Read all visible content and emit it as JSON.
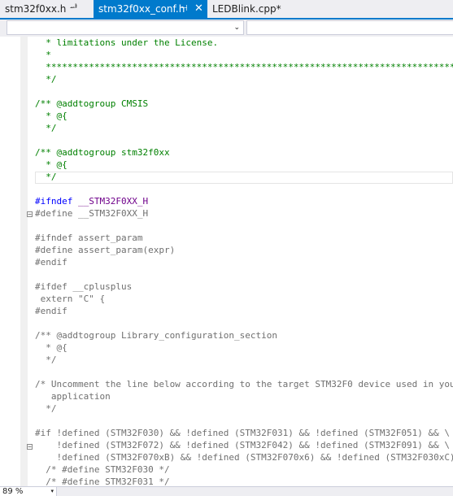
{
  "tabs": [
    {
      "label": "stm32f0xx.h",
      "pin": "ᆄ"
    },
    {
      "label": "stm32f0xx_conf.h",
      "pin": "⊣",
      "close": "✕"
    },
    {
      "label": "LEDBlink.cpp*"
    }
  ],
  "nav": {
    "scope_value": "",
    "member_value": "",
    "dropdown_glyph": "⌄"
  },
  "code_lines": [
    [
      {
        "t": "  * limitations under the License.",
        "c": "cm"
      }
    ],
    [
      {
        "t": "  *",
        "c": "cm"
      }
    ],
    [
      {
        "t": "  ******************************************************************************",
        "c": "cm"
      }
    ],
    [
      {
        "t": "  */",
        "c": "cm"
      }
    ],
    [
      {
        "t": "",
        "c": "cm"
      }
    ],
    [
      {
        "t": "/** @addtogroup CMSIS",
        "c": "cm"
      }
    ],
    [
      {
        "t": "  * @{",
        "c": "cm"
      }
    ],
    [
      {
        "t": "  */",
        "c": "cm"
      }
    ],
    [
      {
        "t": "",
        "c": "cm"
      }
    ],
    [
      {
        "t": "/** @addtogroup stm32f0xx",
        "c": "cm"
      }
    ],
    [
      {
        "t": "  * @{",
        "c": "cm"
      }
    ],
    [
      {
        "t": "  */",
        "c": "cm"
      }
    ],
    [
      {
        "t": "",
        "c": "cm"
      }
    ],
    [
      {
        "t": "#ifndef ",
        "c": "kw"
      },
      {
        "t": "__STM32F0XX_H",
        "c": "macro"
      }
    ],
    [
      {
        "t": "#define __STM32F0XX_H",
        "c": "dim"
      }
    ],
    [
      {
        "t": "",
        "c": "dim"
      }
    ],
    [
      {
        "t": "#ifndef assert_param",
        "c": "dim"
      }
    ],
    [
      {
        "t": "#define assert_param(expr)",
        "c": "dim"
      }
    ],
    [
      {
        "t": "#endif",
        "c": "dim"
      }
    ],
    [
      {
        "t": "",
        "c": "dim"
      }
    ],
    [
      {
        "t": "#ifdef __cplusplus",
        "c": "dim"
      }
    ],
    [
      {
        "t": " extern \"C\" {",
        "c": "dim"
      }
    ],
    [
      {
        "t": "#endif",
        "c": "dim"
      }
    ],
    [
      {
        "t": "",
        "c": "dim"
      }
    ],
    [
      {
        "t": "/** @addtogroup Library_configuration_section",
        "c": "dim"
      }
    ],
    [
      {
        "t": "  * @{",
        "c": "dim"
      }
    ],
    [
      {
        "t": "  */",
        "c": "dim"
      }
    ],
    [
      {
        "t": "",
        "c": "dim"
      }
    ],
    [
      {
        "t": "/* Uncomment the line below according to the target STM32F0 device used in your",
        "c": "dim"
      }
    ],
    [
      {
        "t": "   application",
        "c": "dim"
      }
    ],
    [
      {
        "t": "  */",
        "c": "dim"
      }
    ],
    [
      {
        "t": "",
        "c": "dim"
      }
    ],
    [
      {
        "t": "#if !defined (STM32F030) && !defined (STM32F031) && !defined (STM32F051) && \\",
        "c": "dim"
      }
    ],
    [
      {
        "t": "    !defined (STM32F072) && !defined (STM32F042) && !defined (STM32F091) && \\",
        "c": "dim"
      }
    ],
    [
      {
        "t": "    !defined (STM32F070xB) && !defined (STM32F070x6) && !defined (STM32F030xC)",
        "c": "dim"
      }
    ],
    [
      {
        "t": "  /* #define STM32F030 */",
        "c": "dim"
      }
    ],
    [
      {
        "t": "  /* #define STM32F031 */",
        "c": "dim"
      }
    ]
  ],
  "status": {
    "zoom": "89 %",
    "dropdown_glyph": "▾"
  }
}
